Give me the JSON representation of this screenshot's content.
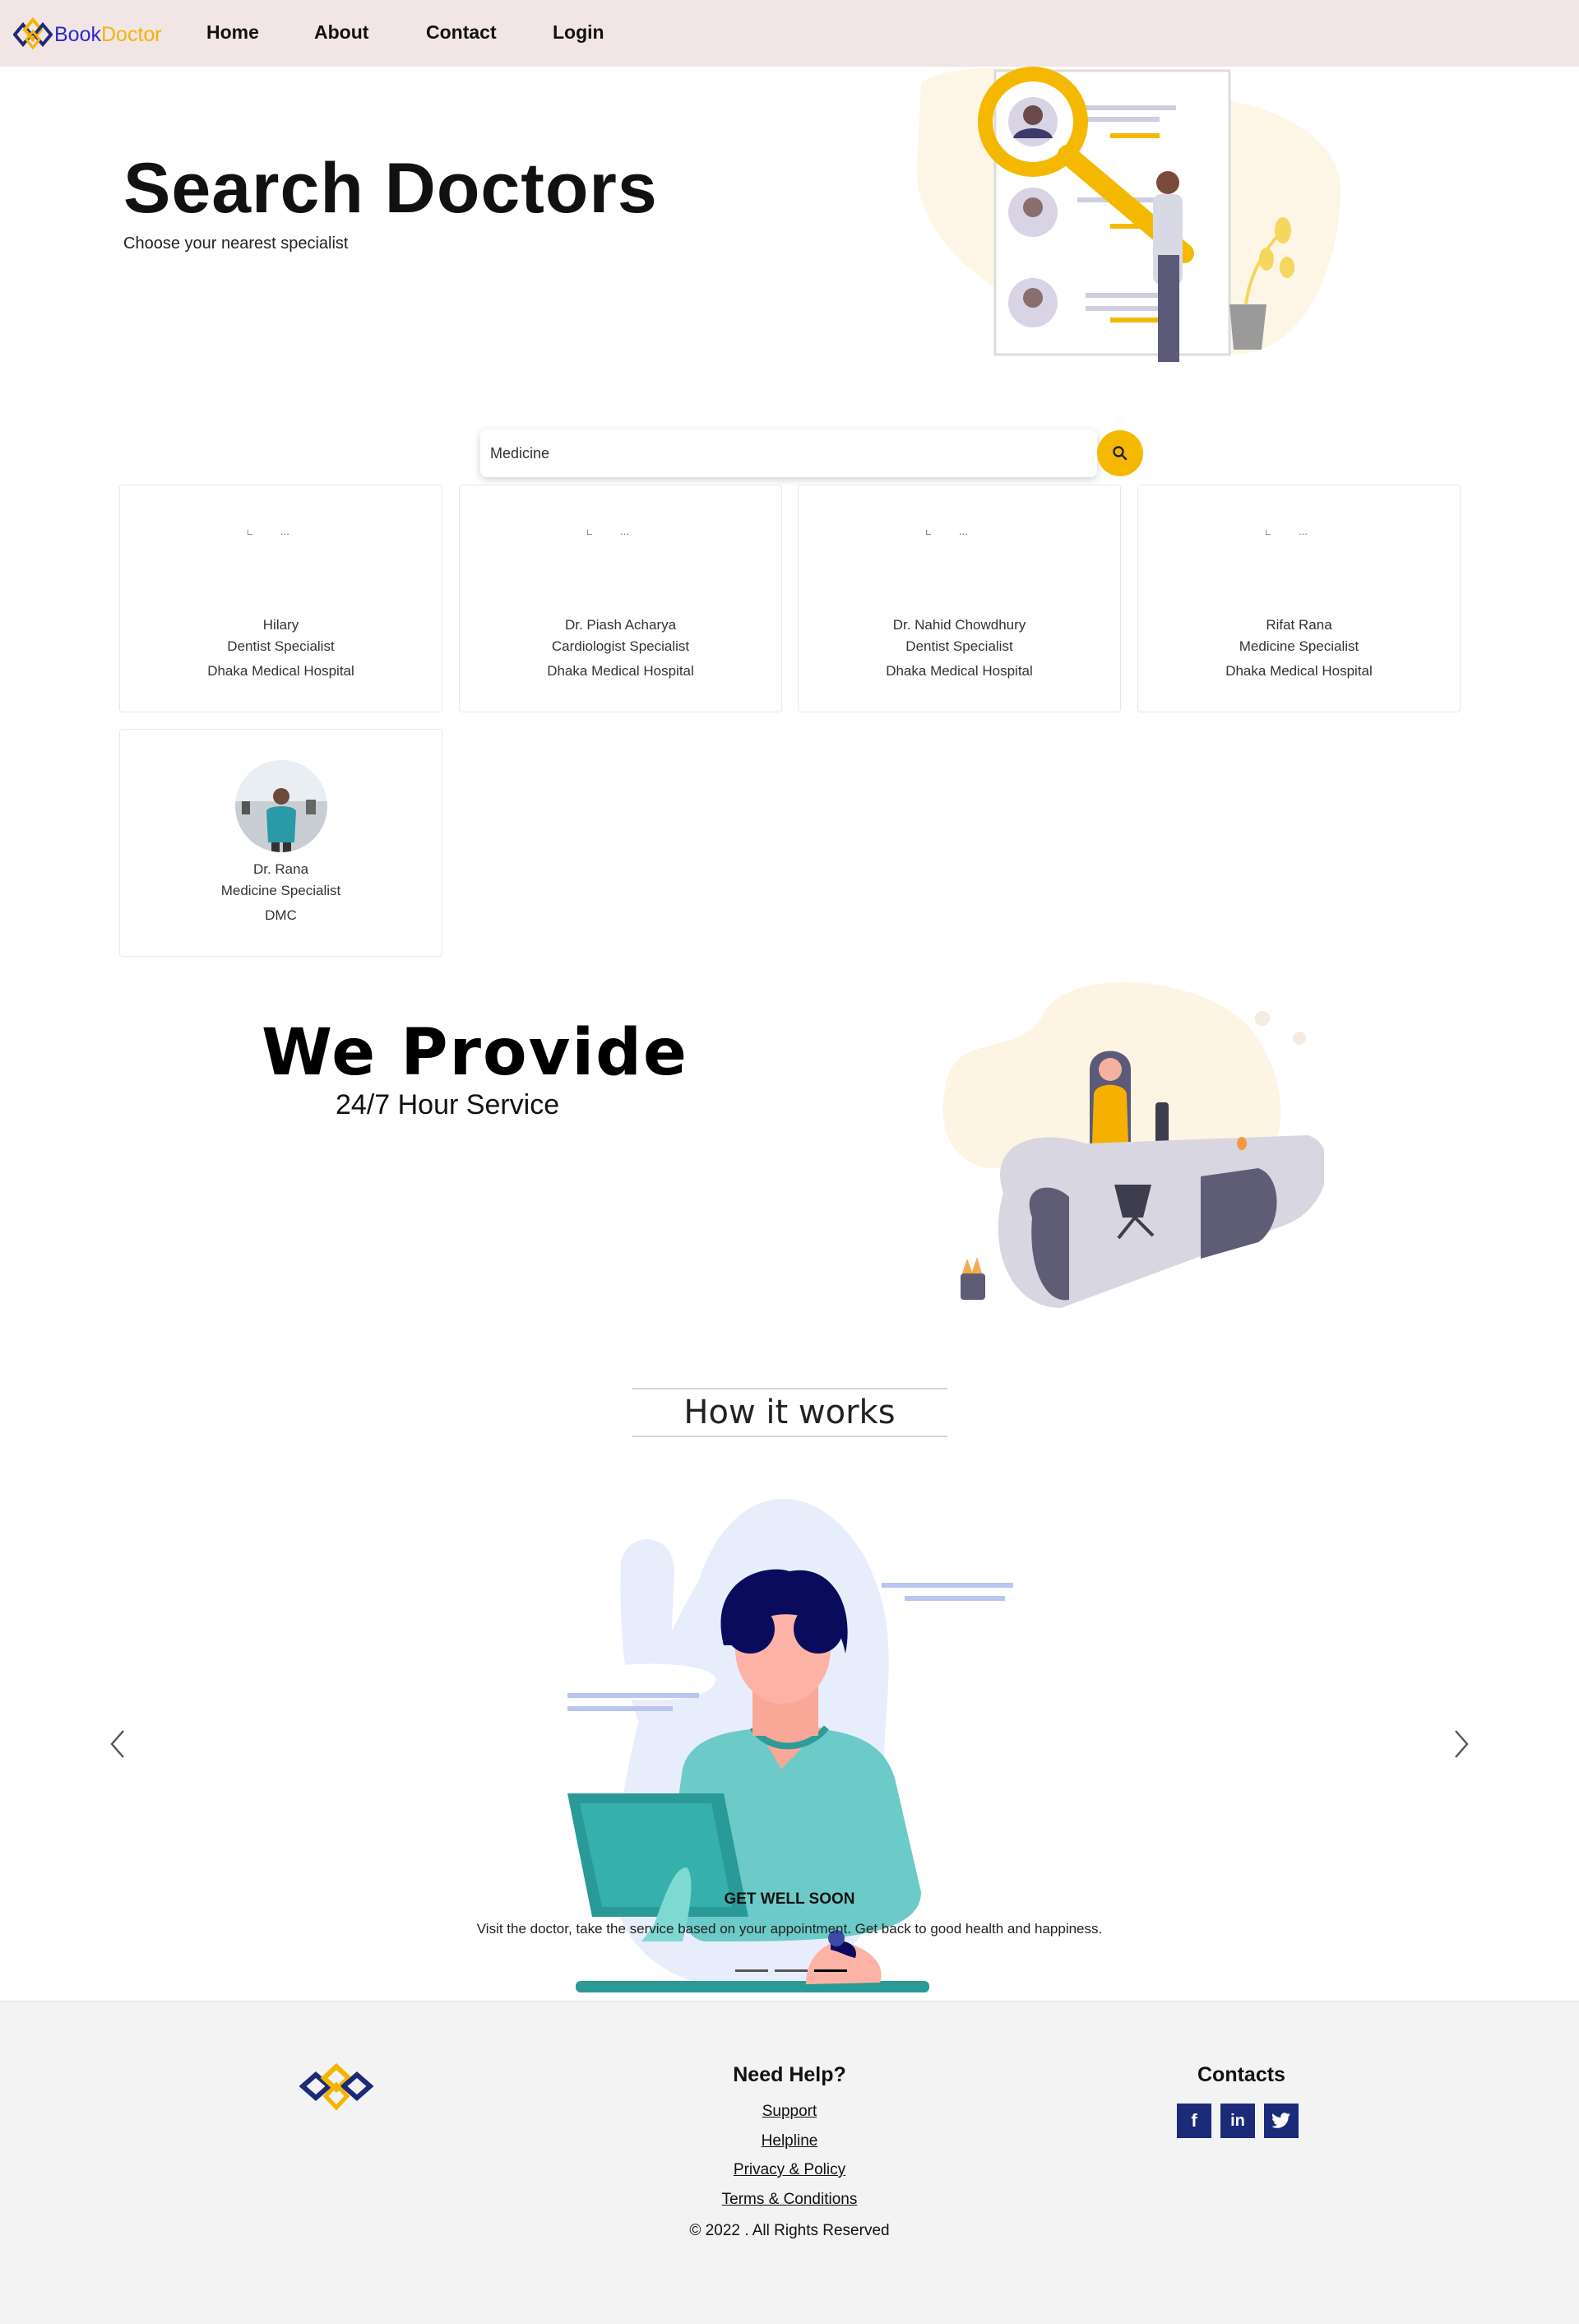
{
  "nav": {
    "brand_part1": "Book",
    "brand_part2": "Doctor",
    "links": [
      "Home",
      "About",
      "Contact",
      "Login"
    ]
  },
  "hero": {
    "title": "Search Doctors",
    "subtitle": "Choose your nearest specialist"
  },
  "search": {
    "value": "Medicine",
    "button_icon": "search-icon"
  },
  "doctors": [
    {
      "name": "Hilary",
      "specialty": "Dentist Specialist",
      "hospital": "Dhaka Medical Hospital",
      "image_alt": "..."
    },
    {
      "name": "Dr. Piash Acharya",
      "specialty": "Cardiologist Specialist",
      "hospital": "Dhaka Medical Hospital",
      "image_alt": "..."
    },
    {
      "name": "Dr. Nahid Chowdhury",
      "specialty": "Dentist Specialist",
      "hospital": "Dhaka Medical Hospital",
      "image_alt": "..."
    },
    {
      "name": "Rifat Rana",
      "specialty": "Medicine Specialist",
      "hospital": "Dhaka Medical Hospital",
      "image_alt": "..."
    },
    {
      "name": "Dr. Rana",
      "specialty": "Medicine Specialist",
      "hospital": "DMC"
    }
  ],
  "provide": {
    "title": "We Provide",
    "subtitle": "24/7 Hour Service"
  },
  "how": {
    "title": "How it works",
    "slide_title": "GET WELL SOON",
    "slide_text": "Visit the doctor, take the service based on your appointment. Get back to good health and happiness.",
    "active_slide": 3,
    "slide_count": 3
  },
  "footer": {
    "help_title": "Need Help?",
    "links": [
      "Support",
      "Helpline",
      "Privacy & Policy",
      "Terms & Conditions"
    ],
    "copyright": "© 2022 . All Rights Reserved",
    "contacts_title": "Contacts",
    "social": [
      {
        "icon": "facebook-icon",
        "glyph": "f"
      },
      {
        "icon": "linkedin-icon",
        "glyph": "in"
      },
      {
        "icon": "twitter-icon",
        "glyph": "🐦"
      }
    ]
  },
  "colors": {
    "navbar_bg": "#f1e5e5",
    "brand_blue": "#2b2bcf",
    "accent_yellow": "#f5b800",
    "footer_bg": "#f3f3f3",
    "social_bg": "#1c2a7a"
  }
}
